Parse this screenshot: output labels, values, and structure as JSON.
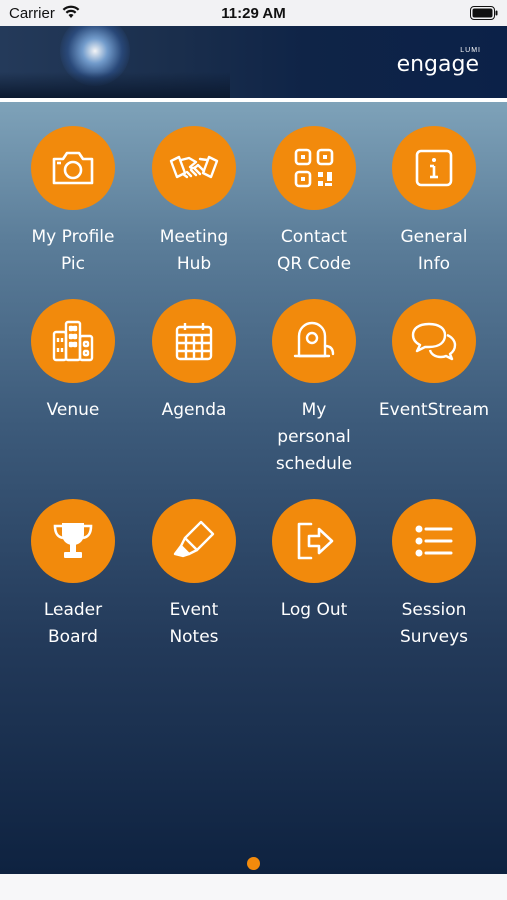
{
  "status_bar": {
    "carrier": "Carrier",
    "time": "11:29 AM"
  },
  "brand": {
    "name": "engage",
    "sub": "LUMI"
  },
  "colors": {
    "accent": "#f28a0c",
    "header": "#0b2148"
  },
  "tiles": [
    {
      "label": "My Profile\nPic",
      "icon": "camera-icon"
    },
    {
      "label": "Meeting\nHub",
      "icon": "handshake-icon"
    },
    {
      "label": "Contact\nQR Code",
      "icon": "qr-code-icon"
    },
    {
      "label": "General\nInfo",
      "icon": "info-icon"
    },
    {
      "label": "Venue",
      "icon": "buildings-icon"
    },
    {
      "label": "Agenda",
      "icon": "calendar-icon"
    },
    {
      "label": "My\npersonal\nschedule",
      "icon": "schedule-icon"
    },
    {
      "label": "EventStream",
      "icon": "chat-bubbles-icon"
    },
    {
      "label": "Leader\nBoard",
      "icon": "trophy-icon"
    },
    {
      "label": "Event\nNotes",
      "icon": "highlighter-icon"
    },
    {
      "label": "Log Out",
      "icon": "logout-icon"
    },
    {
      "label": "Session\nSurveys",
      "icon": "list-icon"
    }
  ],
  "pager": {
    "pages": 1,
    "current": 1
  }
}
